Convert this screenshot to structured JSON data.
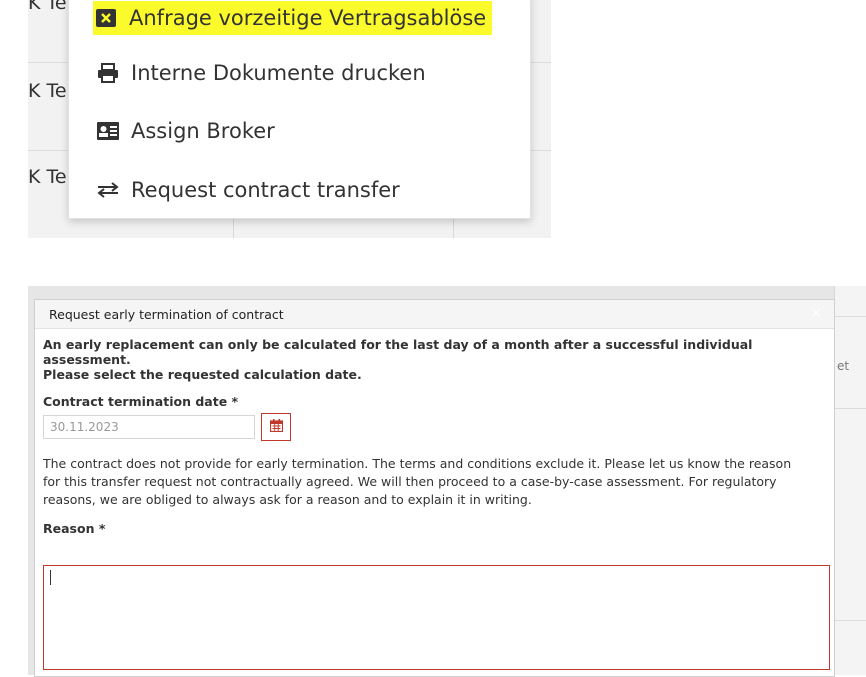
{
  "background_rows": {
    "row_text": "K Te"
  },
  "context_menu": {
    "items": [
      {
        "label": "Anfrage vorzeitige Vertragsablöse",
        "icon": "close-square-icon",
        "highlighted": true
      },
      {
        "label": "Interne Dokumente drucken",
        "icon": "printer-icon",
        "highlighted": false
      },
      {
        "label": "Assign Broker",
        "icon": "id-card-icon",
        "highlighted": false
      },
      {
        "label": "Request contract transfer",
        "icon": "transfer-arrows-icon",
        "highlighted": false
      }
    ],
    "highlight_color": "#fbfb2b"
  },
  "modal": {
    "title": "Request early termination of contract",
    "close": "×",
    "intro_line1": "An early replacement can only be calculated for the last day of a month after a successful individual",
    "intro_line2": "assessment.",
    "intro_line3": "Please select the requested calculation date.",
    "termination_label": "Contract termination date *",
    "termination_value": "30.11.2023",
    "info_line1": "The contract does not provide for early termination. The terms and conditions exclude it. Please let us know the reason",
    "info_line2": "for this transfer request not contractually agreed. We will then proceed to a case-by-case assessment. For regulatory",
    "info_line3": "reasons, we are obliged to always ask for a reason and to explain it in writing.",
    "reason_label": "Reason *",
    "reason_value": "",
    "error_color": "#c0392b"
  },
  "background_right": {
    "cut_text": "et"
  }
}
